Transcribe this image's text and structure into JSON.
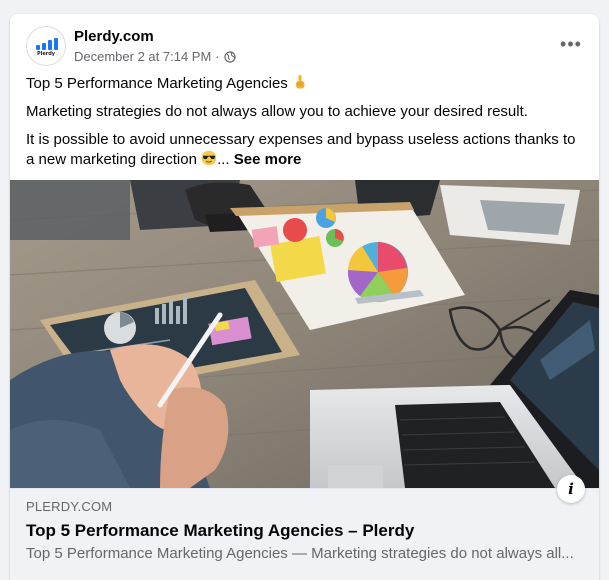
{
  "post": {
    "page_name": "Plerdy.com",
    "avatar_text": "Plerdy",
    "timestamp": "December 2 at 7:14 PM",
    "separator": "·",
    "more_label": "•••",
    "line1": "Top 5 Performance Marketing Agencies",
    "line2": "Marketing strategies do not always allow you to achieve your desired result.",
    "line3": "It is possible to avoid unnecessary expenses and bypass useless actions thanks to a new marketing direction",
    "ellipsis": "...",
    "see_more": "See more"
  },
  "link": {
    "domain": "PLERDY.COM",
    "title": "Top 5 Performance Marketing Agencies – Plerdy",
    "description": "Top 5 Performance Marketing Agencies — Marketing strategies do not always all...",
    "info_label": "i"
  },
  "icons": {
    "globe": "globe-icon",
    "pointing": "pointing-up-hand-icon",
    "sunglasses": "sunglasses-face-icon",
    "more": "more-options-icon",
    "info": "info-icon"
  },
  "colors": {
    "brand_blue": "#1877f2",
    "meta_gray": "#65676b",
    "background": "#f0f2f5"
  }
}
